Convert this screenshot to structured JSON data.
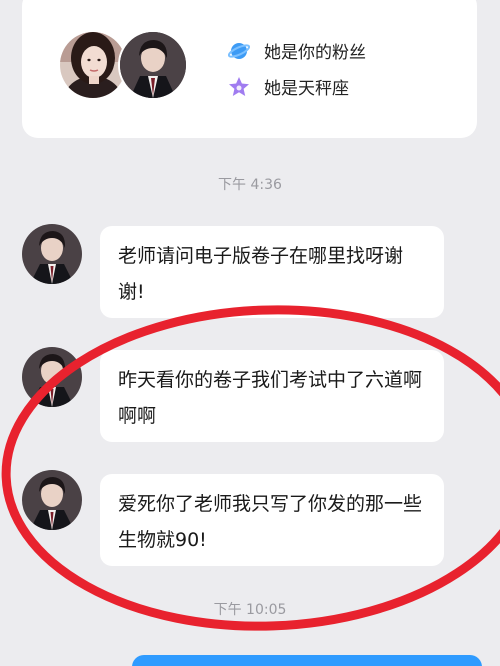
{
  "profile": {
    "tags": [
      {
        "icon": "planet-icon",
        "label": "她是你的粉丝",
        "color": "#3d9bf5"
      },
      {
        "icon": "star-icon",
        "label": "她是天秤座",
        "color": "#a07cf0"
      }
    ]
  },
  "chat": {
    "timestamps": [
      "下午 4:36",
      "下午 10:05"
    ],
    "messages": [
      {
        "text": "老师请问电子版卷子在哪里找呀谢谢!"
      },
      {
        "text": "昨天看你的卷子我们考试中了六道啊啊啊"
      },
      {
        "text": "爱死你了老师我只写了你发的那一些生物就90!"
      }
    ]
  },
  "colors": {
    "background": "#ececef",
    "bubble": "#ffffff",
    "annotation_circle": "#e8222e",
    "sent_bubble": "#2f9bff"
  }
}
